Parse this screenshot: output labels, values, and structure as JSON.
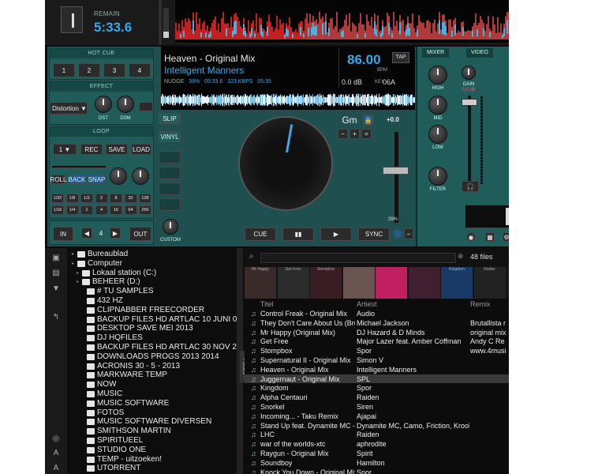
{
  "deck": {
    "remain_label": "REMAIN",
    "remain_time": "5:33.6",
    "hotcue_title": "HOT CUE",
    "hotcue_buttons": [
      "1",
      "2",
      "3",
      "4"
    ],
    "effect_title": "EFFECT",
    "effect_name": "Distortion",
    "effect_knobs": [
      "DST",
      "DSM"
    ],
    "loop_title": "LOOP",
    "loop_size": "1",
    "loop_buttons": [
      "REC",
      "SAVE",
      "LOAD"
    ],
    "loop_modes": [
      "ROLL",
      "BACK",
      "SNAP"
    ],
    "loop_lengths": [
      "1/32",
      "1/8",
      "1/2",
      "2",
      "8",
      "32",
      "128",
      "1/16",
      "1/4",
      "1",
      "4",
      "16",
      "64",
      "256"
    ],
    "in_label": "IN",
    "out_label": "OUT",
    "loop_count": "4",
    "slip": "SLIP",
    "vinyl": "VINYL",
    "custom": "CUSTOM",
    "title": "Heaven - Original Mix",
    "artist": "Intelligent Manners",
    "nudge": "NUDGE",
    "pct": "39%",
    "time": "05:33.6",
    "kbps": "323 KBPS",
    "len": "05:35",
    "bpm": "86.00",
    "bpm_label": "BPM",
    "tap": "TAP",
    "gain": "0.0 dB",
    "key_label": "KEY",
    "key_code": "06A",
    "key_name": "Gm",
    "pitch": "+0.0",
    "pitch_pct": "39%",
    "cue": "CUE",
    "play": "▶",
    "pause": "▮▮",
    "sync": "SYNC",
    "minus": "−",
    "plus": "+",
    "progress": 0.39
  },
  "mixer": {
    "tab_mixer": "MIXER",
    "tab_video": "VIDEO",
    "knobs": [
      "HIGH",
      "MID",
      "LOW",
      "FILTER"
    ],
    "gain": "GAIN",
    "gain_db": "0.0 dB"
  },
  "browser": {
    "files_count": "48 files",
    "folders": [
      {
        "label": "Bureaublad",
        "level": 0
      },
      {
        "label": "Computer",
        "level": 0
      },
      {
        "label": "Lokaal station (C:)",
        "level": 1
      },
      {
        "label": "BEHEER (D:)",
        "level": 1
      },
      {
        "label": "# TU SAMPLES",
        "level": 2
      },
      {
        "label": "432 HZ",
        "level": 2
      },
      {
        "label": "CLIPNABBER FREECORDER",
        "level": 2
      },
      {
        "label": "BACKUP FILES HD ARTLAC 10 JUNI 09",
        "level": 2
      },
      {
        "label": "DESKTOP SAVE MEI 2013",
        "level": 2
      },
      {
        "label": "DJ HQFILES",
        "level": 2
      },
      {
        "label": "BACKUP FILES HD ARTLAC 30 NOV 2011",
        "level": 2
      },
      {
        "label": "DOWNLOADS PROGS 2013 2014",
        "level": 2
      },
      {
        "label": "ACRONIS 30 - 5 - 2013",
        "level": 2
      },
      {
        "label": "MARKWARE TEMP",
        "level": 2
      },
      {
        "label": "NOW",
        "level": 2
      },
      {
        "label": "MUSIC",
        "level": 2
      },
      {
        "label": "MUSIC SOFTWARE",
        "level": 2
      },
      {
        "label": "FOTOS",
        "level": 2
      },
      {
        "label": "MUSIC SOFTWARE DIVERSEN",
        "level": 2
      },
      {
        "label": "SMITHSON MARTIN",
        "level": 2
      },
      {
        "label": "SPIRITUEEL",
        "level": 2
      },
      {
        "label": "STUDIO ONE",
        "level": 2
      },
      {
        "label": "TEMP - uitzoeken!",
        "level": 2
      },
      {
        "label": "UTORRENT",
        "level": 2
      }
    ],
    "sidebar_tab": "Folders",
    "covers": [
      {
        "label": "Mr Happy"
      },
      {
        "label": "Get Free"
      },
      {
        "label": "Stompbox"
      },
      {
        "label": ""
      },
      {
        "label": ""
      },
      {
        "label": ""
      },
      {
        "label": "Kingdom"
      },
      {
        "label": "Raidor"
      }
    ],
    "columns": [
      "Titel",
      "Artiest",
      "Remix"
    ],
    "rows": [
      {
        "title": "Control Freak - Original Mix",
        "artist": "Audio",
        "remix": ""
      },
      {
        "title": "They Don't Care About Us (Brutallista re...",
        "artist": "Michael Jackson",
        "remix": "Brutallista r"
      },
      {
        "title": "Mr Happy (Original Mix)",
        "artist": "DJ Hazard & D Minds",
        "remix": "original mix"
      },
      {
        "title": "Get Free",
        "artist": "Major Lazer feat. Amber Coffman",
        "remix": "Andy C Re"
      },
      {
        "title": "Stompbox",
        "artist": "Spor",
        "remix": "www.4musi"
      },
      {
        "title": "Supernatural II - Original Mix",
        "artist": "Simon V",
        "remix": ""
      },
      {
        "title": "Heaven - Original Mix",
        "artist": "Intelligent Manners",
        "remix": ""
      },
      {
        "title": "Juggernaut - Original Mix",
        "artist": "SPL",
        "remix": ""
      },
      {
        "title": "Kingdom",
        "artist": "Spor",
        "remix": ""
      },
      {
        "title": "Alpha Centauri",
        "artist": "Raiden",
        "remix": ""
      },
      {
        "title": "Snorkel",
        "artist": "Siren",
        "remix": ""
      },
      {
        "title": "Incoming... - Taku Remix",
        "artist": "Ajapai",
        "remix": ""
      },
      {
        "title": "Stand Up feat. Dynamite MC - Original ...",
        "artist": "Dynamite MC, Camo, Friction, Krooked",
        "remix": ""
      },
      {
        "title": "LHC",
        "artist": "Raiden",
        "remix": ""
      },
      {
        "title": "war of the worlds-xtc",
        "artist": "aphrodite",
        "remix": ""
      },
      {
        "title": "Raygun - Original Mix",
        "artist": "Spirit",
        "remix": ""
      },
      {
        "title": "Soundboy",
        "artist": "Hamilton",
        "remix": ""
      },
      {
        "title": "Knock You Down - Original Mix",
        "artist": "Spor",
        "remix": ""
      }
    ],
    "selected_index": 7
  }
}
